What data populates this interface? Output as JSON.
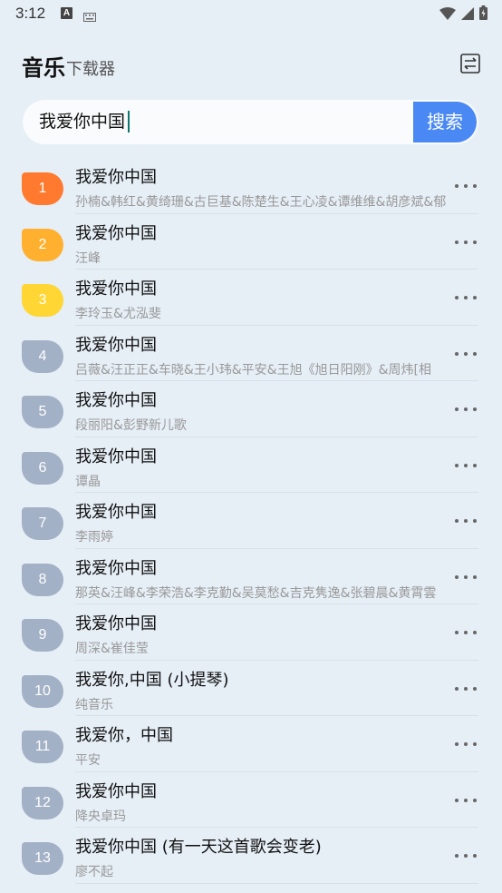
{
  "status": {
    "time": "3:12",
    "a_icon": "A"
  },
  "header": {
    "title_main": "音乐",
    "title_sub": "下载器",
    "switch_icon": "swap-icon"
  },
  "search": {
    "value": "我爱你中国",
    "button_label": "搜索"
  },
  "songs": [
    {
      "rank": "1",
      "title": "我爱你中国",
      "artist": "孙楠&韩红&黄绮珊&古巨基&陈楚生&王心凌&谭维维&胡彦斌&郁",
      "color": "#ff7a2e"
    },
    {
      "rank": "2",
      "title": "我爱你中国",
      "artist": "汪峰",
      "color": "#ffb02e"
    },
    {
      "rank": "3",
      "title": "我爱你中国",
      "artist": "李玲玉&尤泓斐",
      "color": "#ffd633"
    },
    {
      "rank": "4",
      "title": "我爱你中国",
      "artist": "吕薇&汪正正&车晓&王小玮&平安&王旭《旭日阳刚》&周炜[相",
      "color": "#a3b1c6"
    },
    {
      "rank": "5",
      "title": "我爱你中国",
      "artist": "段丽阳&彭野新儿歌",
      "color": "#a3b1c6"
    },
    {
      "rank": "6",
      "title": "我爱你中国",
      "artist": "谭晶",
      "color": "#a3b1c6"
    },
    {
      "rank": "7",
      "title": "我爱你中国",
      "artist": "李雨婷",
      "color": "#a3b1c6"
    },
    {
      "rank": "8",
      "title": "我爱你中国",
      "artist": "那英&汪峰&李荣浩&李克勤&吴莫愁&吉克隽逸&张碧晨&黄霄雲",
      "color": "#a3b1c6"
    },
    {
      "rank": "9",
      "title": "我爱你中国",
      "artist": "周深&崔佳莹",
      "color": "#a3b1c6"
    },
    {
      "rank": "10",
      "title": "我爱你,中国 (小提琴)",
      "artist": "纯音乐",
      "color": "#a3b1c6"
    },
    {
      "rank": "11",
      "title": "我爱你，中国",
      "artist": "平安",
      "color": "#a3b1c6"
    },
    {
      "rank": "12",
      "title": "我爱你中国",
      "artist": "降央卓玛",
      "color": "#a3b1c6"
    },
    {
      "rank": "13",
      "title": "我爱你中国 (有一天这首歌会变老)",
      "artist": "廖不起",
      "color": "#a3b1c6"
    }
  ],
  "more_icon": "more-horizontal-icon"
}
